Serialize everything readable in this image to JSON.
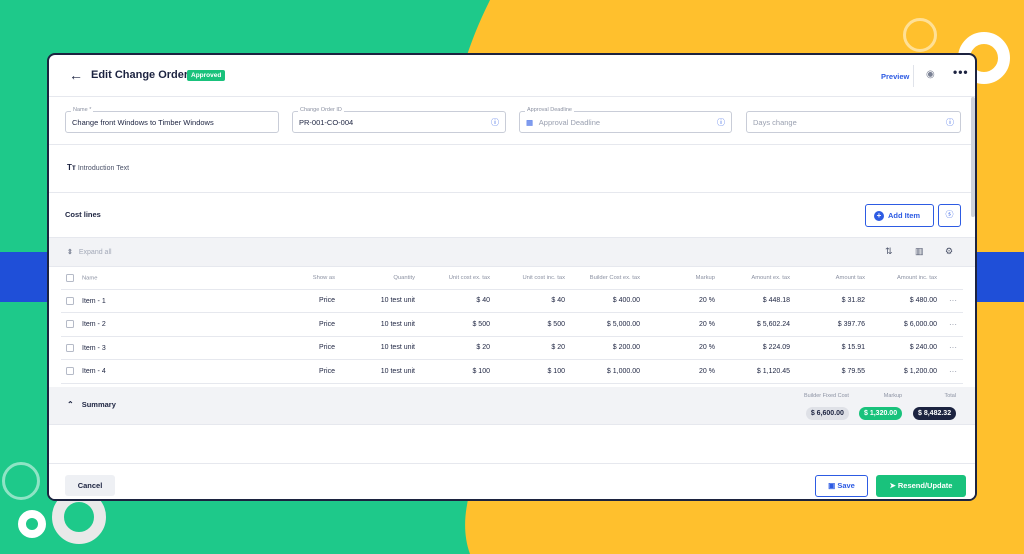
{
  "colors": {
    "accent": "#2d5be3",
    "success": "#19c27c",
    "dark": "#1c2340",
    "background_green": "#1ec98a",
    "background_yellow": "#ffc02d",
    "background_band": "#1f4fd8"
  },
  "header": {
    "title": "Edit Change Order",
    "status_badge": "Approved",
    "preview_label": "Preview",
    "back_icon": "arrow-left-icon",
    "view_icon": "eye-icon",
    "more_icon": "more-horizontal-icon"
  },
  "fields": {
    "name": {
      "label": "Name *",
      "value": "Change front Windows to Timber Windows"
    },
    "change_order_id": {
      "label": "Change Order ID",
      "value": "PR-001-CO-004"
    },
    "approval_deadline": {
      "label": "Approval Deadline",
      "placeholder": "Approval Deadline"
    },
    "days_change": {
      "placeholder": "Days change"
    }
  },
  "intro": {
    "icon": "text-format-icon",
    "label": "Introduction Text"
  },
  "cost_lines": {
    "title": "Cost lines",
    "add_item_label": "Add Item",
    "expand_all_label": "Expand all",
    "columns": [
      "Name",
      "Show as",
      "Quantity",
      "Unit cost ex. tax",
      "Unit cost inc. tax",
      "Builder Cost ex. tax",
      "Markup",
      "Amount ex. tax",
      "Amount tax",
      "Amount inc. tax"
    ],
    "rows": [
      {
        "name": "Item - 1",
        "show_as": "Price",
        "quantity": "10 test unit",
        "unit_ex": "$ 40",
        "unit_inc": "$ 40",
        "builder_cost": "$ 400.00",
        "markup": "20 %",
        "amount_ex": "$ 448.18",
        "amount_tax": "$ 31.82",
        "amount_inc": "$ 480.00"
      },
      {
        "name": "Item - 2",
        "show_as": "Price",
        "quantity": "10 test unit",
        "unit_ex": "$ 500",
        "unit_inc": "$ 500",
        "builder_cost": "$ 5,000.00",
        "markup": "20 %",
        "amount_ex": "$ 5,602.24",
        "amount_tax": "$ 397.76",
        "amount_inc": "$ 6,000.00"
      },
      {
        "name": "Item - 3",
        "show_as": "Price",
        "quantity": "10 test unit",
        "unit_ex": "$ 20",
        "unit_inc": "$ 20",
        "builder_cost": "$ 200.00",
        "markup": "20 %",
        "amount_ex": "$ 224.09",
        "amount_tax": "$ 15.91",
        "amount_inc": "$ 240.00"
      },
      {
        "name": "Item - 4",
        "show_as": "Price",
        "quantity": "10 test unit",
        "unit_ex": "$ 100",
        "unit_inc": "$ 100",
        "builder_cost": "$ 1,000.00",
        "markup": "20 %",
        "amount_ex": "$ 1,120.45",
        "amount_tax": "$ 79.55",
        "amount_inc": "$ 1,200.00"
      }
    ]
  },
  "summary": {
    "label": "Summary",
    "builder_fixed_cost_label": "Builder Fixed Cost",
    "builder_fixed_cost": "$ 6,600.00",
    "markup_label": "Markup",
    "markup": "$ 1,320.00",
    "total_label": "Total",
    "total": "$ 8,482.32"
  },
  "footer": {
    "cancel_label": "Cancel",
    "save_label": "Save",
    "resend_label": "Resend/Update"
  }
}
